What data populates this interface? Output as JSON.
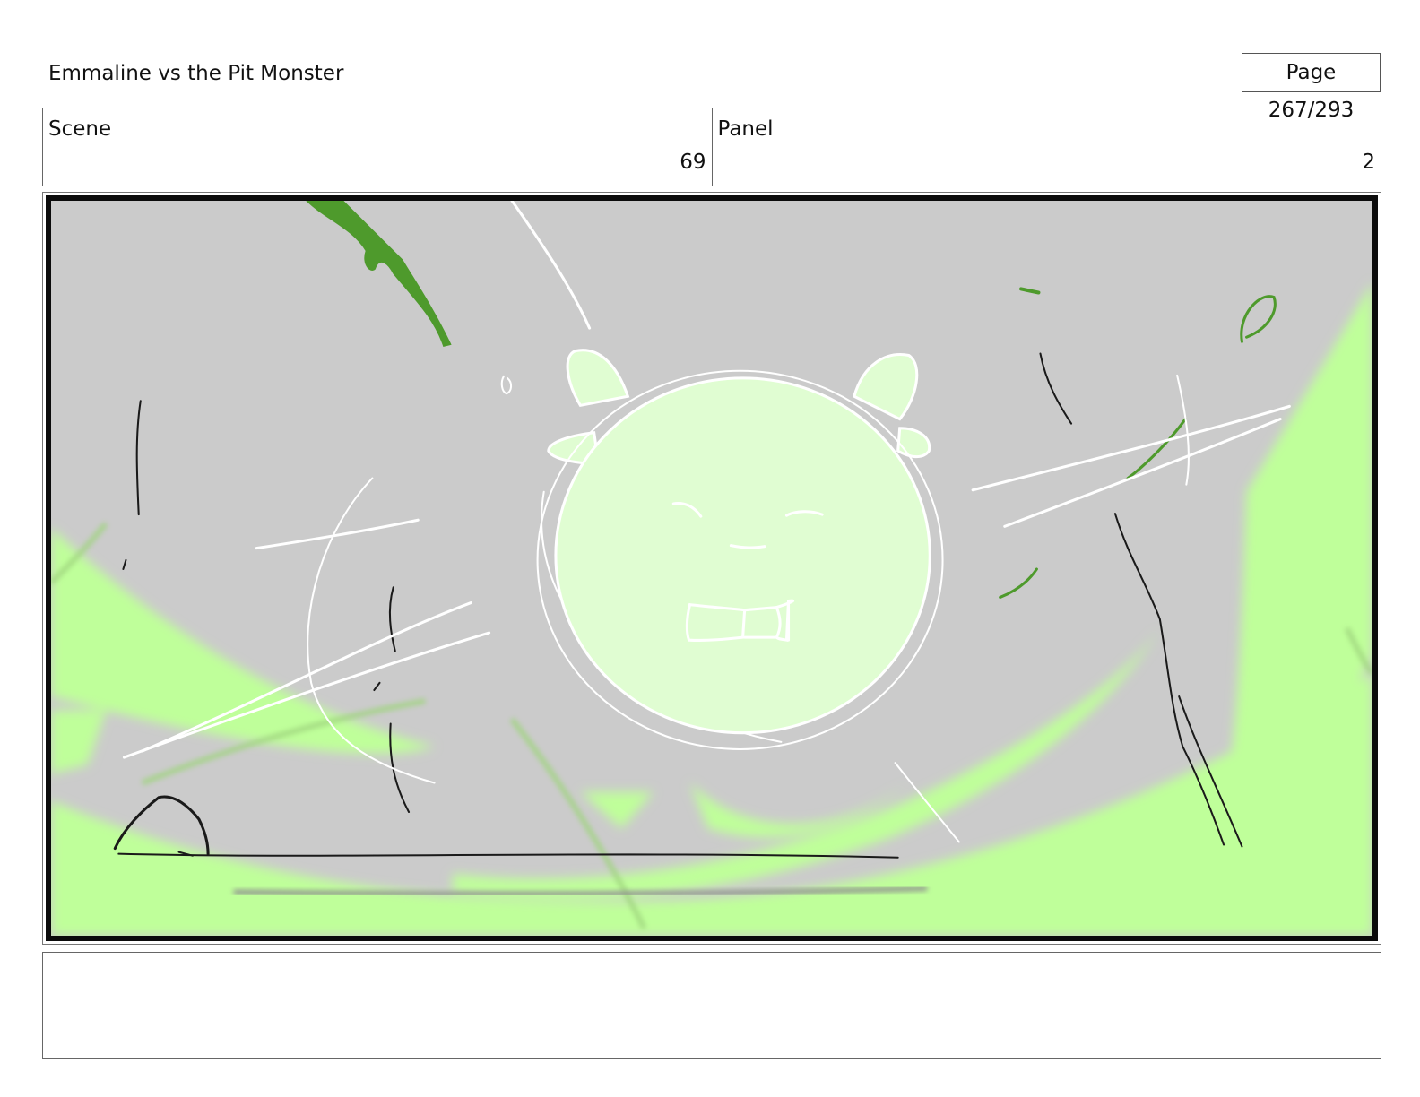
{
  "header": {
    "title": "Emmaline vs the Pit Monster",
    "page": "Page 267/293"
  },
  "info": {
    "scene_label": "Scene",
    "scene_value": "69",
    "panel_label": "Panel",
    "panel_value": "2"
  },
  "panel_art": {
    "background_color": "#cbcbcb",
    "accent_color": "#bfff9a",
    "character_fill": "#e0fdd2",
    "dark_green": "#4e9a2c"
  },
  "notes": {
    "text": ""
  }
}
